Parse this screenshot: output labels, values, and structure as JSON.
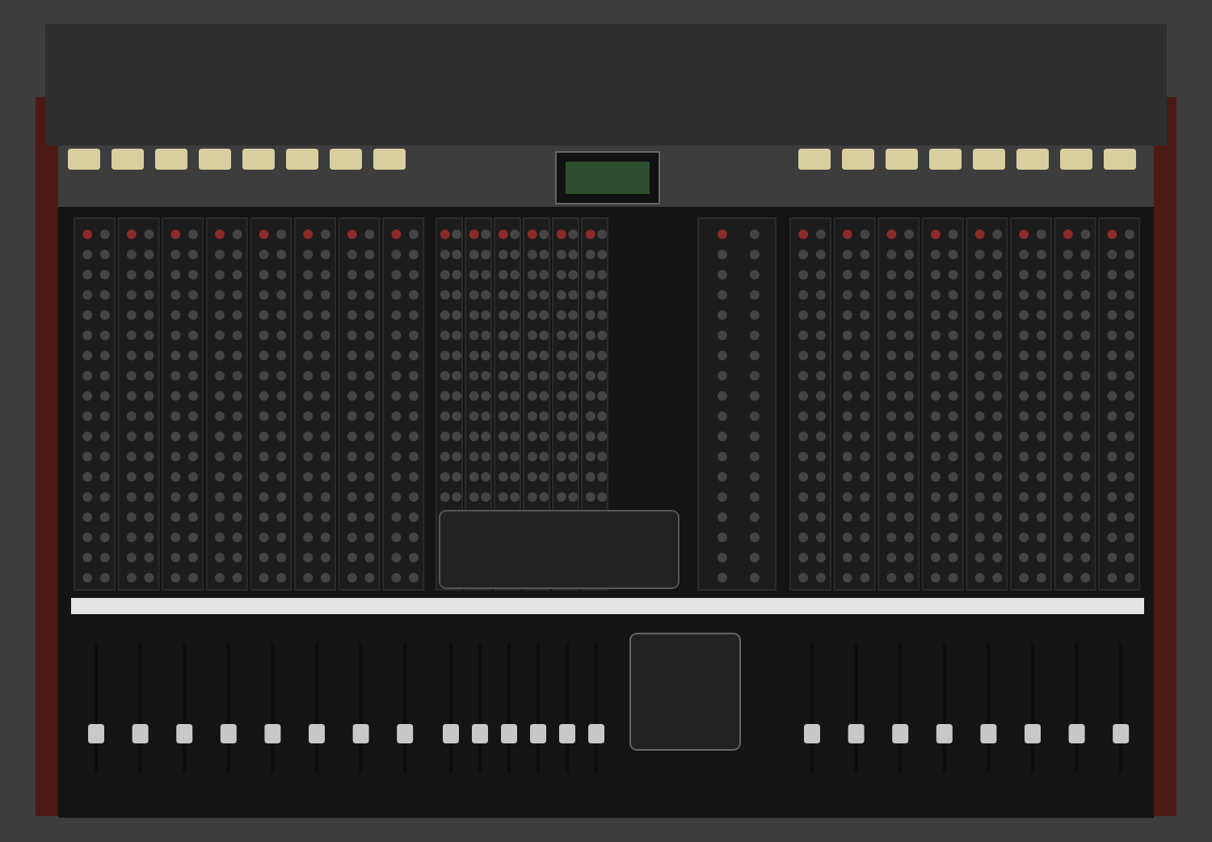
{
  "photo": {
    "kind": "mixing-console"
  }
}
